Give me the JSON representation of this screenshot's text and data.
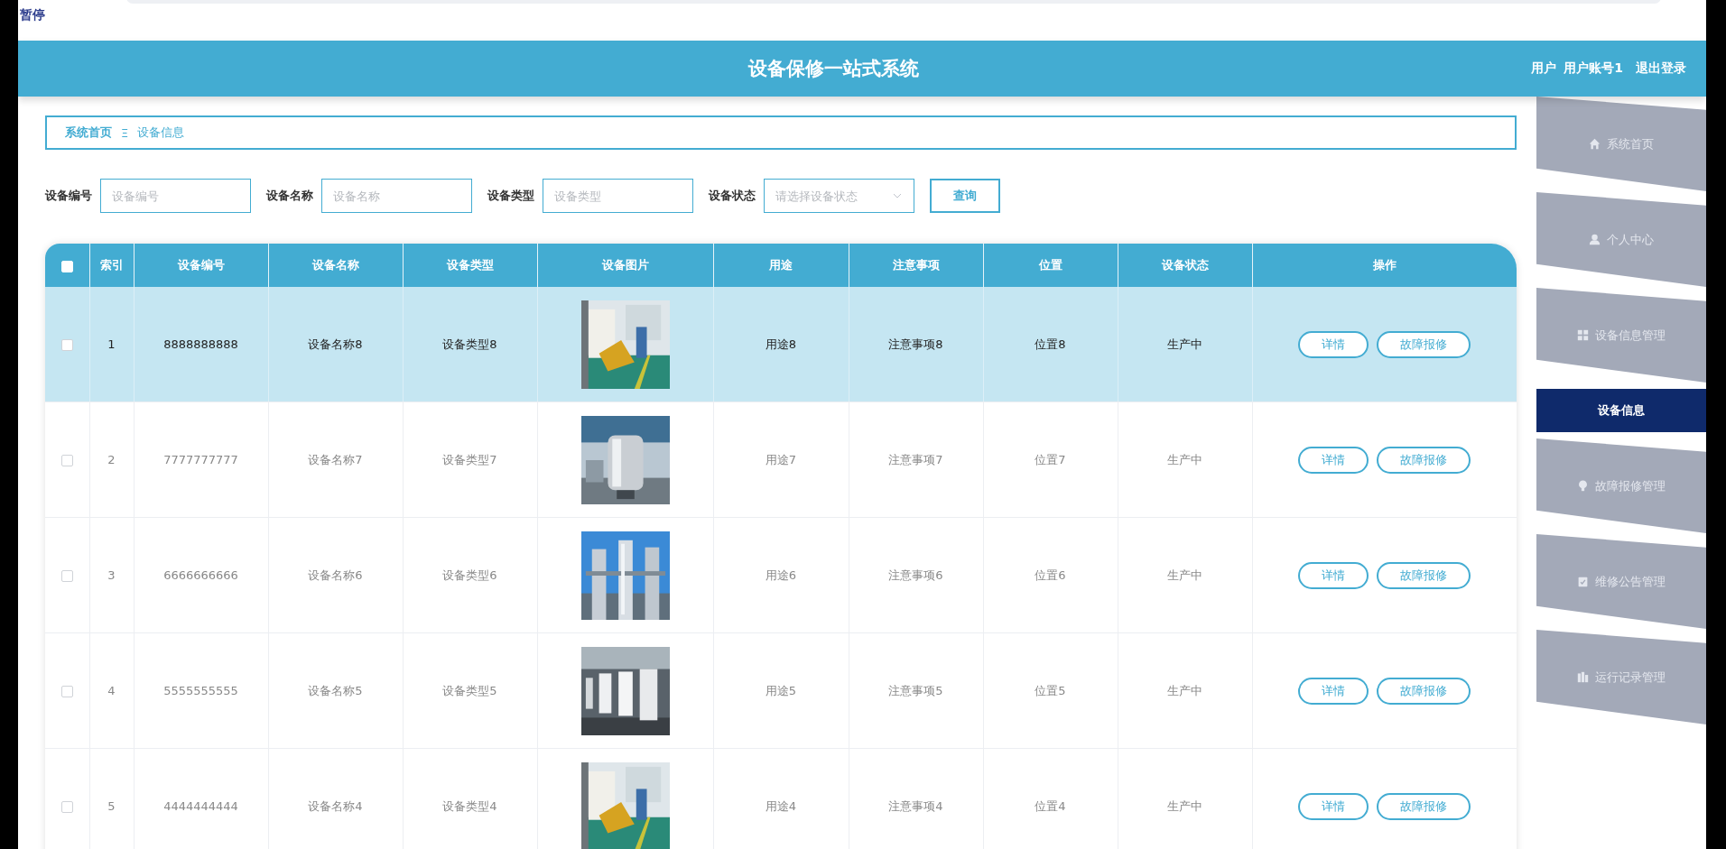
{
  "status_text": "暂停",
  "header": {
    "title": "设备保修一站式系统",
    "user_role": "用户",
    "username": "用户账号1",
    "logout": "退出登录"
  },
  "breadcrumb": {
    "items": [
      {
        "label": "系统首页"
      },
      {
        "label": "设备信息"
      }
    ],
    "separator": "Ξ"
  },
  "search": {
    "fields": [
      {
        "label": "设备编号",
        "placeholder": "设备编号",
        "kind": "text"
      },
      {
        "label": "设备名称",
        "placeholder": "设备名称",
        "kind": "text"
      },
      {
        "label": "设备类型",
        "placeholder": "设备类型",
        "kind": "text"
      },
      {
        "label": "设备状态",
        "placeholder": "请选择设备状态",
        "kind": "select"
      }
    ],
    "button": "查询"
  },
  "table": {
    "select_all_checked": false,
    "columns": [
      "索引",
      "设备编号",
      "设备名称",
      "设备类型",
      "设备图片",
      "用途",
      "注意事项",
      "位置",
      "设备状态",
      "操作"
    ],
    "rows": [
      {
        "selected": true,
        "checked": false,
        "index": "1",
        "code": "8888888888",
        "name": "设备名称8",
        "type": "设备类型8",
        "use": "用途8",
        "notes": "注意事项8",
        "location": "位置8",
        "status": "生产中",
        "actions": [
          "详情",
          "故障报修"
        ]
      },
      {
        "selected": false,
        "checked": false,
        "index": "2",
        "code": "7777777777",
        "name": "设备名称7",
        "type": "设备类型7",
        "use": "用途7",
        "notes": "注意事项7",
        "location": "位置7",
        "status": "生产中",
        "actions": [
          "详情",
          "故障报修"
        ]
      },
      {
        "selected": false,
        "checked": false,
        "index": "3",
        "code": "6666666666",
        "name": "设备名称6",
        "type": "设备类型6",
        "use": "用途6",
        "notes": "注意事项6",
        "location": "位置6",
        "status": "生产中",
        "actions": [
          "详情",
          "故障报修"
        ]
      },
      {
        "selected": false,
        "checked": false,
        "index": "4",
        "code": "5555555555",
        "name": "设备名称5",
        "type": "设备类型5",
        "use": "用途5",
        "notes": "注意事项5",
        "location": "位置5",
        "status": "生产中",
        "actions": [
          "详情",
          "故障报修"
        ]
      },
      {
        "selected": false,
        "checked": false,
        "index": "5",
        "code": "4444444444",
        "name": "设备名称4",
        "type": "设备类型4",
        "use": "用途4",
        "notes": "注意事项4",
        "location": "位置4",
        "status": "生产中",
        "actions": [
          "详情",
          "故障报修"
        ]
      }
    ]
  },
  "sidebar": {
    "items": [
      {
        "label": "系统首页",
        "selected": false
      },
      {
        "label": "个人中心",
        "selected": false
      },
      {
        "label": "设备信息管理",
        "selected": false
      },
      {
        "label": "设备信息",
        "selected": true
      },
      {
        "label": "故障报修管理",
        "selected": false
      },
      {
        "label": "维修公告管理",
        "selected": false
      },
      {
        "label": "运行记录管理",
        "selected": false
      }
    ]
  }
}
